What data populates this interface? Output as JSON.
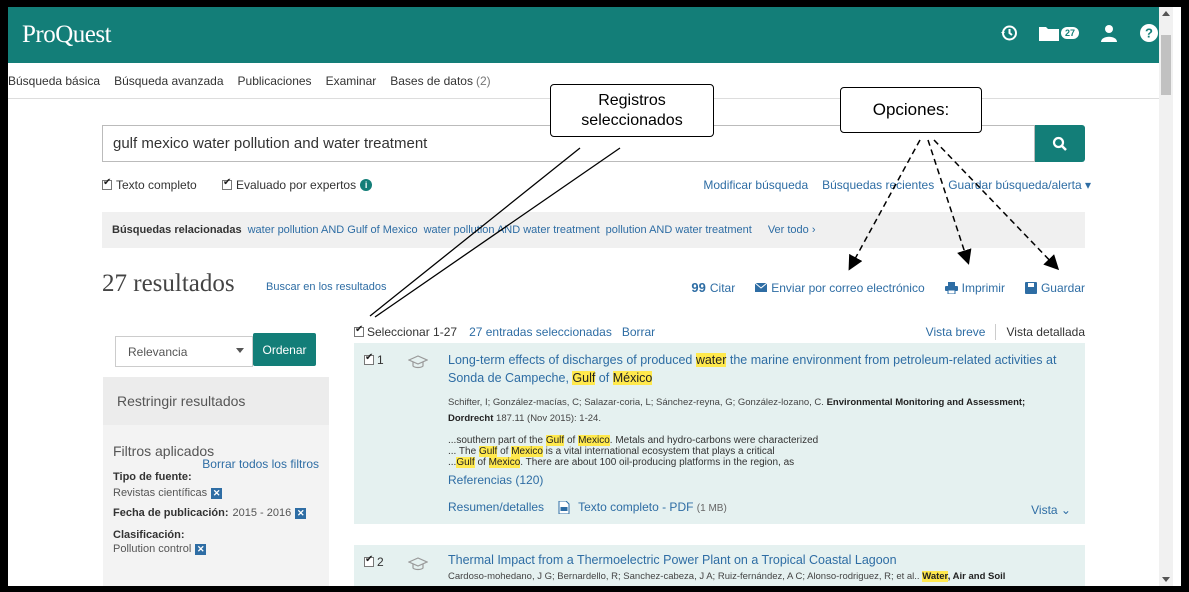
{
  "brand": "ProQuest",
  "header": {
    "folder_count": "27"
  },
  "nav": {
    "basic": "Búsqueda básica",
    "advanced": "Búsqueda avanzada",
    "publications": "Publicaciones",
    "browse": "Examinar",
    "databases": "Bases de datos",
    "databases_count": "(2)"
  },
  "search": {
    "query": "gulf mexico water pollution and water treatment"
  },
  "options": {
    "full_text": "Texto completo",
    "peer_reviewed": "Evaluado por expertos",
    "modify": "Modificar búsqueda",
    "recent": "Búsquedas recientes",
    "save_alert": "Guardar búsqueda/alerta"
  },
  "related": {
    "label": "Búsquedas relacionadas",
    "items": [
      "water pollution AND Gulf of Mexico",
      "water pollution AND water treatment",
      "pollution AND water treatment"
    ],
    "see_all": "Ver todo ›"
  },
  "results": {
    "count": "27 resultados",
    "within": "Buscar en los resultados",
    "cite": "Citar",
    "email": "Enviar por correo electrónico",
    "print": "Imprimir",
    "save": "Guardar"
  },
  "sidebar": {
    "sort_value": "Relevancia",
    "sort_button": "Ordenar",
    "narrow": "Restringir resultados",
    "applied": "Filtros aplicados",
    "clear_all": "Borrar todos los filtros",
    "source_type_label": "Tipo de fuente:",
    "source_type_value": "Revistas científicas",
    "pub_date_label": "Fecha de publicación:",
    "pub_date_value": "2015 - 2016",
    "class_label": "Clasificación:",
    "class_value": "Pollution control"
  },
  "list": {
    "select": "Seleccionar 1-27",
    "selected": "27 entradas seleccionadas",
    "clear": "Borrar",
    "brief": "Vista breve",
    "detailed": "Vista detallada"
  },
  "item1": {
    "num": "1",
    "title_a": "Long-term effects of discharges of produced ",
    "title_hl1": "water",
    "title_b": " the marine environment from petroleum-related activities at Sonda de Campeche, ",
    "title_hl2": "Gulf",
    "title_c": " of ",
    "title_hl3": "México",
    "authors": "Schifter, I; González-macías, C; Salazar-coria, L; Sánchez-reyna, G; González-lozano, C. ",
    "journal": "Environmental Monitoring and Assessment; Dordrecht",
    "citation": " 187.11  (Nov 2015): 1-24.",
    "snip1_a": "...southern part of the ",
    "snip1_b": ". Metals and hydro-carbons were characterized",
    "snip2_a": "... The ",
    "snip2_b": " is a vital international ecosystem that plays a critical",
    "snip3_a": "...",
    "snip3_b": ". There are about 100 oil-producing platforms in the region, as",
    "w_gulf": "Gulf",
    "w_of": "of",
    "w_mexico": "Mexico",
    "refs": "Referencias (120)",
    "abstract": "Resumen/detalles",
    "pdf": "Texto completo - PDF",
    "pdf_size": "(1 MB)",
    "view": "Vista ⌄"
  },
  "item2": {
    "num": "2",
    "title": "Thermal Impact from a Thermoelectric Power Plant on a Tropical Coastal Lagoon",
    "authors": "Cardoso-mohedano, J G; Bernardello, R; Sanchez-cabeza, J A; Ruiz-fernández, A C; Alonso-rodriguez, R; et al.. ",
    "journal_hl": "Water",
    "journal": ", Air and Soil"
  },
  "callouts": {
    "selected_records": "Registros seleccionados",
    "options": "Opciones:"
  }
}
